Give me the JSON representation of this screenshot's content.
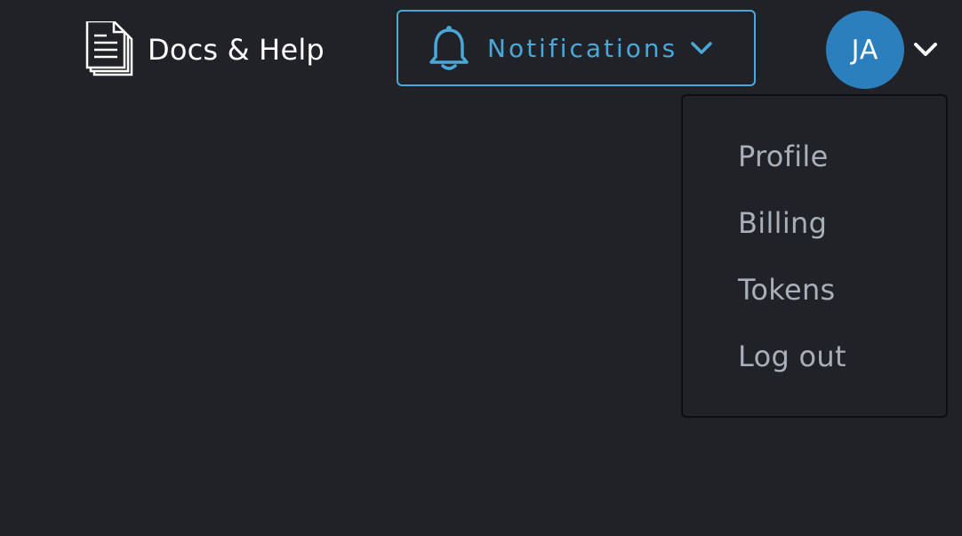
{
  "header": {
    "docs_label": "Docs & Help",
    "docs_icon": "docs-icon",
    "notifications_label": "Notifications",
    "notifications_icon": "bell-icon",
    "avatar_initials": "JA",
    "avatar_color": "#2b7fbd",
    "accent_color": "#4aa8d8"
  },
  "user_menu": {
    "items": [
      {
        "label": "Profile"
      },
      {
        "label": "Billing"
      },
      {
        "label": "Tokens"
      },
      {
        "label": "Log out"
      }
    ]
  }
}
